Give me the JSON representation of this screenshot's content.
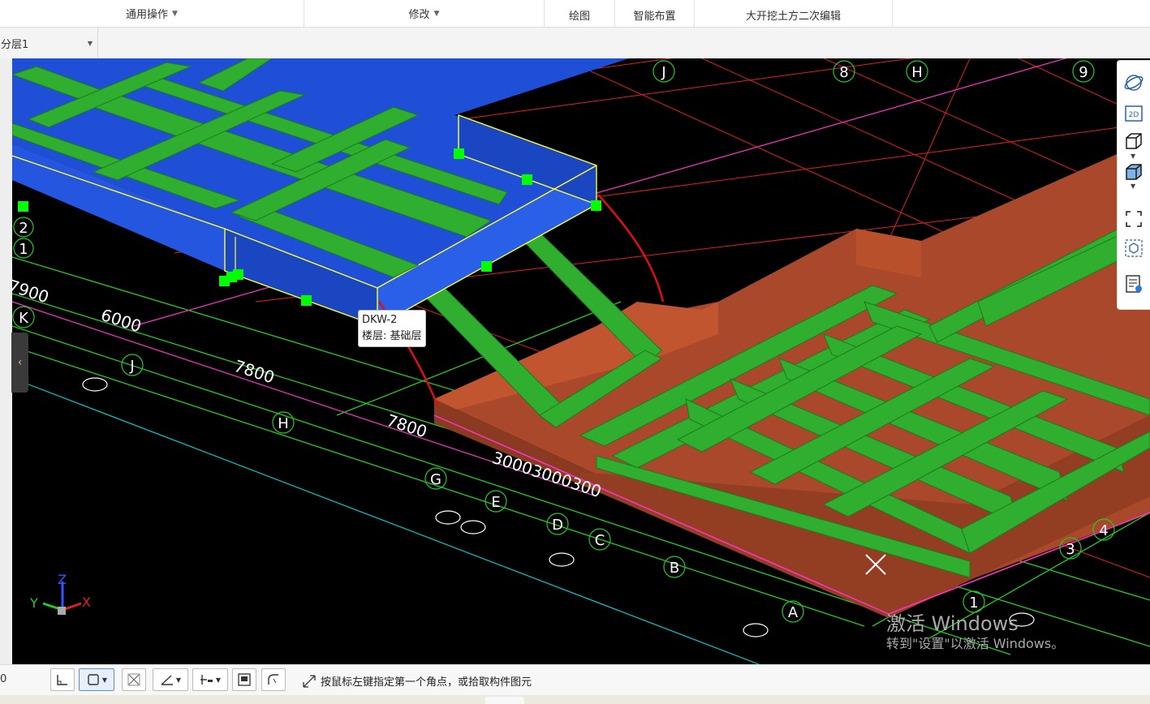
{
  "ribbon": {
    "groups": [
      {
        "label": "通用操作",
        "has_dropdown": true
      },
      {
        "label": "修改",
        "has_dropdown": true
      },
      {
        "label": "绘图",
        "has_dropdown": false
      },
      {
        "label": "智能布置",
        "has_dropdown": false
      },
      {
        "label": "大开挖土方二次编辑",
        "has_dropdown": false
      }
    ]
  },
  "layer_selector": {
    "value": "分层1"
  },
  "viewport": {
    "tooltip": {
      "line1": "DKW-2",
      "line2": "楼层: 基础层"
    },
    "axis_labels": {
      "letters": [
        "J",
        "H",
        "K",
        "J",
        "H",
        "G",
        "E",
        "D",
        "C",
        "B",
        "A"
      ],
      "numbers": [
        "8",
        "9",
        "2",
        "1",
        "4",
        "3",
        "1"
      ]
    },
    "dimensions": [
      "7900",
      "6000",
      "7800",
      "7800",
      "30003000300"
    ],
    "triad": {
      "x": "X",
      "y": "Y",
      "z": "Z"
    },
    "colors": {
      "background": "#000000",
      "slab_blue": "#1f4fd6",
      "beam_green": "#2fae2f",
      "earth_brown": "#a9482a",
      "grid_red": "#e02020",
      "grid_green": "#22cc22",
      "grid_magenta": "#ff33cc",
      "grip_green": "#00ff00",
      "selection_yellow": "#ffff33"
    }
  },
  "view_tools": [
    {
      "icon": "orbit-icon"
    },
    {
      "icon": "view-2d-icon",
      "label": "2D"
    },
    {
      "icon": "view-3d-box-icon"
    },
    {
      "icon": "view-solid-box-icon"
    },
    {
      "icon": "fit-screen-icon"
    },
    {
      "icon": "isolate-icon"
    },
    {
      "icon": "display-settings-icon"
    }
  ],
  "watermark": {
    "line1": "激活 Windows",
    "line2": "转到\"设置\"以激活 Windows。"
  },
  "status": {
    "coord_value": "0",
    "hint": "按鼠标左键指定第一个角点，或拾取构件图元",
    "tools": [
      {
        "icon": "ortho-icon"
      },
      {
        "icon": "rect-select-icon",
        "active": true,
        "has_dropdown": true
      },
      {
        "icon": "cross-select-icon"
      },
      {
        "icon": "angle-icon",
        "has_dropdown": true
      },
      {
        "icon": "offset-icon",
        "has_dropdown": true
      },
      {
        "icon": "layer-display-icon"
      },
      {
        "icon": "arc-icon"
      }
    ]
  }
}
